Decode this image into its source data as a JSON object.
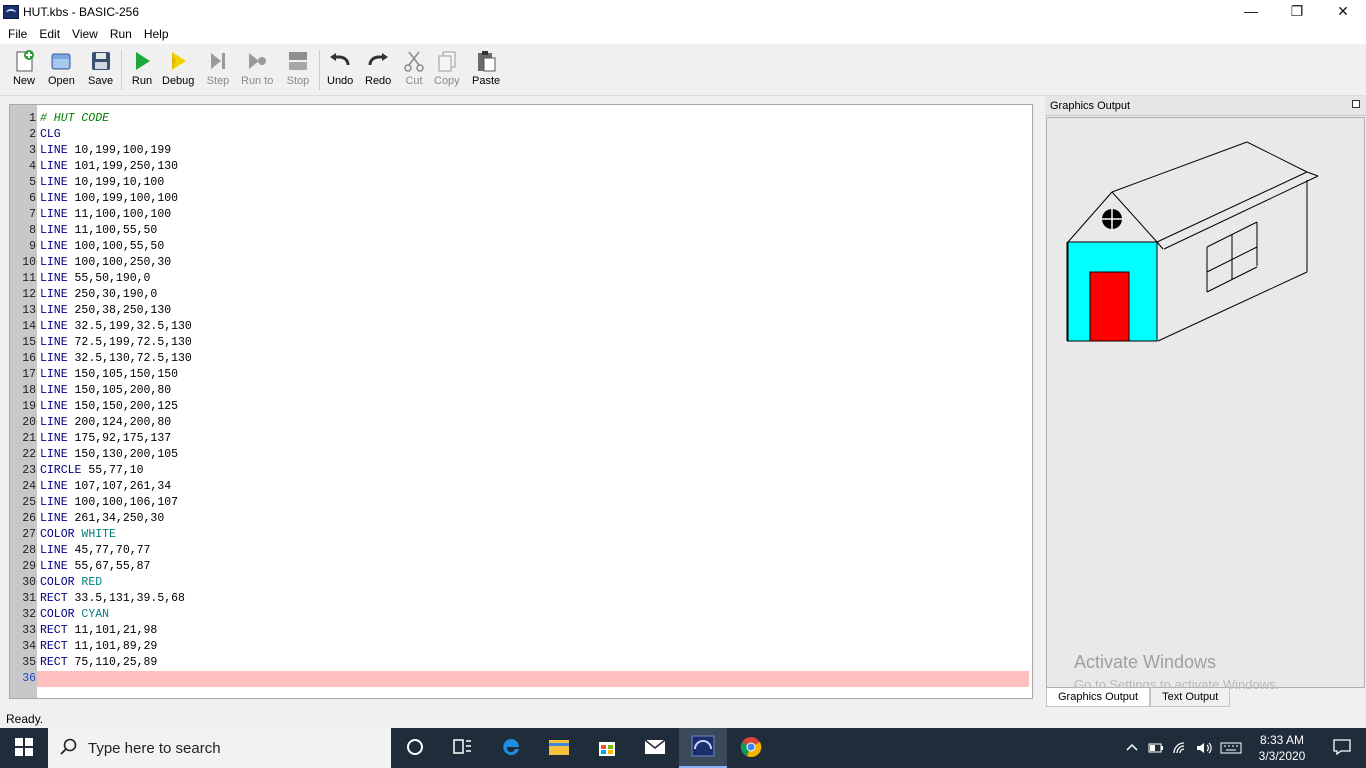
{
  "window": {
    "title": "HUT.kbs - BASIC-256",
    "controls": {
      "minimize": "—",
      "restore": "❐",
      "close": "✕"
    }
  },
  "menu": {
    "items": [
      "File",
      "Edit",
      "View",
      "Run",
      "Help"
    ]
  },
  "toolbar": {
    "buttons": [
      {
        "label": "New",
        "icon": "new-file-icon",
        "enabled": true
      },
      {
        "label": "Open",
        "icon": "open-folder-icon",
        "enabled": true
      },
      {
        "label": "Save",
        "icon": "save-floppy-icon",
        "enabled": true
      },
      {
        "label": "Run",
        "icon": "run-play-icon",
        "enabled": true
      },
      {
        "label": "Debug",
        "icon": "debug-icon",
        "enabled": true
      },
      {
        "label": "Step",
        "icon": "step-icon",
        "enabled": false
      },
      {
        "label": "Run to",
        "icon": "run-to-icon",
        "enabled": false
      },
      {
        "label": "Stop",
        "icon": "stop-icon",
        "enabled": false
      },
      {
        "label": "Undo",
        "icon": "undo-icon",
        "enabled": true
      },
      {
        "label": "Redo",
        "icon": "redo-icon",
        "enabled": true
      },
      {
        "label": "Cut",
        "icon": "scissors-icon",
        "enabled": false
      },
      {
        "label": "Copy",
        "icon": "copy-icon",
        "enabled": false
      },
      {
        "label": "Paste",
        "icon": "clipboard-icon",
        "enabled": true
      }
    ]
  },
  "editor": {
    "current_line": 36,
    "lines": [
      {
        "n": "1",
        "kw": "# HUT CODE",
        "arg": "",
        "type": "comment"
      },
      {
        "n": "2",
        "kw": "CLG",
        "arg": "",
        "type": "stmt"
      },
      {
        "n": "3",
        "kw": "LINE",
        "arg": " 10,199,100,199",
        "type": "stmt"
      },
      {
        "n": "4",
        "kw": "LINE",
        "arg": " 101,199,250,130",
        "type": "stmt"
      },
      {
        "n": "5",
        "kw": "LINE",
        "arg": " 10,199,10,100",
        "type": "stmt"
      },
      {
        "n": "6",
        "kw": "LINE",
        "arg": " 100,199,100,100",
        "type": "stmt"
      },
      {
        "n": "7",
        "kw": "LINE",
        "arg": " 11,100,100,100",
        "type": "stmt"
      },
      {
        "n": "8",
        "kw": "LINE",
        "arg": " 11,100,55,50",
        "type": "stmt"
      },
      {
        "n": "9",
        "kw": "LINE",
        "arg": " 100,100,55,50",
        "type": "stmt"
      },
      {
        "n": "10",
        "kw": "LINE",
        "arg": " 100,100,250,30",
        "type": "stmt"
      },
      {
        "n": "11",
        "kw": "LINE",
        "arg": " 55,50,190,0",
        "type": "stmt"
      },
      {
        "n": "12",
        "kw": "LINE",
        "arg": " 250,30,190,0",
        "type": "stmt"
      },
      {
        "n": "13",
        "kw": "LINE",
        "arg": " 250,38,250,130",
        "type": "stmt"
      },
      {
        "n": "14",
        "kw": "LINE",
        "arg": " 32.5,199,32.5,130",
        "type": "stmt"
      },
      {
        "n": "15",
        "kw": "LINE",
        "arg": " 72.5,199,72.5,130",
        "type": "stmt"
      },
      {
        "n": "16",
        "kw": "LINE",
        "arg": " 32.5,130,72.5,130",
        "type": "stmt"
      },
      {
        "n": "17",
        "kw": "LINE",
        "arg": " 150,105,150,150",
        "type": "stmt"
      },
      {
        "n": "18",
        "kw": "LINE",
        "arg": " 150,105,200,80",
        "type": "stmt"
      },
      {
        "n": "19",
        "kw": "LINE",
        "arg": " 150,150,200,125",
        "type": "stmt"
      },
      {
        "n": "20",
        "kw": "LINE",
        "arg": " 200,124,200,80",
        "type": "stmt"
      },
      {
        "n": "21",
        "kw": "LINE",
        "arg": " 175,92,175,137",
        "type": "stmt"
      },
      {
        "n": "22",
        "kw": "LINE",
        "arg": " 150,130,200,105",
        "type": "stmt"
      },
      {
        "n": "23",
        "kw": "CIRCLE",
        "arg": " 55,77,10",
        "type": "stmt"
      },
      {
        "n": "24",
        "kw": "LINE",
        "arg": " 107,107,261,34",
        "type": "stmt"
      },
      {
        "n": "25",
        "kw": "LINE",
        "arg": " 100,100,106,107",
        "type": "stmt"
      },
      {
        "n": "26",
        "kw": "LINE",
        "arg": " 261,34,250,30",
        "type": "stmt"
      },
      {
        "n": "27",
        "kw": "COLOR",
        "arg": " WHITE",
        "type": "color"
      },
      {
        "n": "28",
        "kw": "LINE",
        "arg": " 45,77,70,77",
        "type": "stmt"
      },
      {
        "n": "29",
        "kw": "LINE",
        "arg": " 55,67,55,87",
        "type": "stmt"
      },
      {
        "n": "30",
        "kw": "COLOR",
        "arg": " RED",
        "type": "color"
      },
      {
        "n": "31",
        "kw": "RECT",
        "arg": " 33.5,131,39.5,68",
        "type": "stmt"
      },
      {
        "n": "32",
        "kw": "COLOR",
        "arg": " CYAN",
        "type": "color"
      },
      {
        "n": "33",
        "kw": "RECT",
        "arg": " 11,101,21,98",
        "type": "stmt"
      },
      {
        "n": "34",
        "kw": "RECT",
        "arg": " 11,101,89,29",
        "type": "stmt"
      },
      {
        "n": "35",
        "kw": "RECT",
        "arg": " 75,110,25,89",
        "type": "stmt"
      },
      {
        "n": "36",
        "kw": "",
        "arg": "",
        "type": "current"
      }
    ]
  },
  "graphics_panel": {
    "title": "Graphics Output",
    "tabs": [
      "Graphics Output",
      "Text Output"
    ],
    "active_tab": "Graphics Output",
    "colors": {
      "wall": "#00ffff",
      "door": "#ff0000",
      "outline": "#000000"
    }
  },
  "watermark": {
    "title": "Activate Windows",
    "subtitle": "Go to Settings to activate Windows."
  },
  "status": {
    "text": "Ready."
  },
  "taskbar": {
    "search_placeholder": "Type here to search",
    "time": "8:33 AM",
    "date": "3/3/2020"
  },
  "colors": {
    "keyword": "#000080",
    "comment": "#008000",
    "constant": "#008080",
    "current_line_bg": "#ffbfbf"
  }
}
